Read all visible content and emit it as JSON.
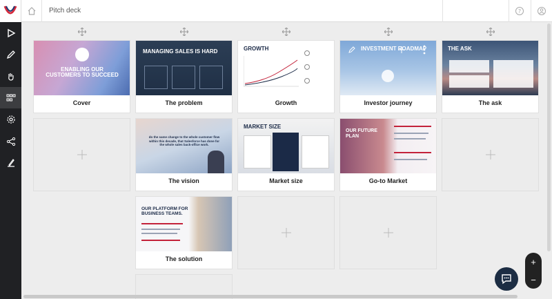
{
  "header": {
    "title": "Pitch deck"
  },
  "sidebar": {
    "items": [
      {
        "name": "play-icon"
      },
      {
        "name": "pen-icon"
      },
      {
        "name": "hand-icon"
      },
      {
        "name": "grid-icon"
      },
      {
        "name": "gear-icon"
      },
      {
        "name": "share-icon"
      },
      {
        "name": "signature-icon"
      }
    ]
  },
  "slides": [
    {
      "label": "Cover",
      "thumb_title": "ENABLING OUR\nCUSTOMERS TO SUCCEED"
    },
    {
      "label": "The problem",
      "thumb_title": "MANAGING SALES IS HARD"
    },
    {
      "label": "Growth",
      "thumb_title": "GROWTH"
    },
    {
      "label": "Investor journey",
      "thumb_title": "INVESTMENT ROADMAP"
    },
    {
      "label": "The ask",
      "thumb_title": "THE ASK"
    },
    {
      "label": "The vision",
      "thumb_title": "do the same change to the whole customer flow within this decade, that Salesforce has done for the whole sales back-office work."
    },
    {
      "label": "Market size",
      "thumb_title": "MARKET SIZE"
    },
    {
      "label": "Go-to Market",
      "thumb_title": "OUR FUTURE PLAN"
    },
    {
      "label": "The solution",
      "thumb_title": "OUR PLATFORM FOR BUSINESS TEAMS."
    }
  ],
  "colors": {
    "accent": "#1c2d43",
    "sidebar": "#202124"
  }
}
